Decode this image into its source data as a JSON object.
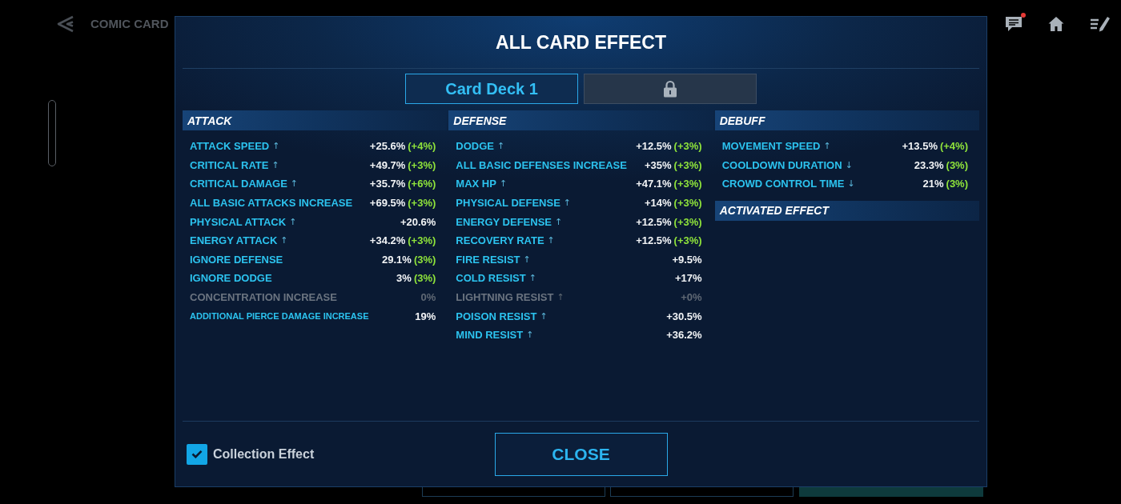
{
  "top_bar": {
    "title": "COMIC CARD",
    "chat_unread": true
  },
  "dialog": {
    "title": "ALL CARD EFFECT",
    "tabs": [
      {
        "label": "Card Deck 1",
        "selected": true,
        "locked": false
      },
      {
        "selected": false,
        "locked": true
      }
    ],
    "columns": [
      {
        "sections": [
          {
            "title": "ATTACK",
            "rows": [
              {
                "label": "ATTACK SPEED",
                "arrow": "↑",
                "value": "+25.6%",
                "bonus": "(+4%)",
                "disabled": false,
                "kind": "normal"
              },
              {
                "label": "CRITICAL RATE",
                "arrow": "↑",
                "value": "+49.7%",
                "bonus": "(+3%)",
                "disabled": false,
                "kind": "normal"
              },
              {
                "label": "CRITICAL DAMAGE",
                "arrow": "↑",
                "value": "+35.7%",
                "bonus": "(+6%)",
                "disabled": false,
                "kind": "normal"
              },
              {
                "label": "ALL BASIC ATTACKS INCREASE",
                "value": "+69.5%",
                "bonus": "(+3%)",
                "disabled": false,
                "kind": "normal"
              },
              {
                "label": "PHYSICAL ATTACK",
                "arrow": "↑",
                "value": "+20.6%",
                "disabled": false,
                "kind": "normal"
              },
              {
                "label": "ENERGY ATTACK",
                "arrow": "↑",
                "value": "+34.2%",
                "bonus": "(+3%)",
                "disabled": false,
                "kind": "normal"
              },
              {
                "label": "IGNORE DEFENSE",
                "value": "29.1%",
                "bonus": "(3%)",
                "disabled": false,
                "kind": "normal"
              },
              {
                "label": "IGNORE DODGE",
                "value": "3%",
                "bonus": "(3%)",
                "disabled": false,
                "kind": "normal"
              },
              {
                "label": "CONCENTRATION INCREASE",
                "value": "0%",
                "disabled": true,
                "kind": "normal"
              },
              {
                "label": "ADDITIONAL PIERCE DAMAGE INCREASE",
                "value": "19%",
                "disabled": false,
                "kind": "small"
              }
            ]
          }
        ]
      },
      {
        "sections": [
          {
            "title": "DEFENSE",
            "rows": [
              {
                "label": "DODGE",
                "arrow": "↑",
                "value": "+12.5%",
                "bonus": "(+3%)",
                "disabled": false,
                "kind": "normal"
              },
              {
                "label": "ALL BASIC DEFENSES INCREASE",
                "value": "+35%",
                "bonus": "(+3%)",
                "disabled": false,
                "kind": "normal"
              },
              {
                "label": "MAX HP",
                "arrow": "↑",
                "value": "+47.1%",
                "bonus": "(+3%)",
                "disabled": false,
                "kind": "normal"
              },
              {
                "label": "PHYSICAL DEFENSE",
                "arrow": "↑",
                "value": "+14%",
                "bonus": "(+3%)",
                "disabled": false,
                "kind": "normal"
              },
              {
                "label": "ENERGY DEFENSE",
                "arrow": "↑",
                "value": "+12.5%",
                "bonus": "(+3%)",
                "disabled": false,
                "kind": "normal"
              },
              {
                "label": "RECOVERY RATE",
                "arrow": "↑",
                "value": "+12.5%",
                "bonus": "(+3%)",
                "disabled": false,
                "kind": "normal"
              },
              {
                "label": "FIRE RESIST",
                "arrow": "↑",
                "value": "+9.5%",
                "disabled": false,
                "kind": "normal"
              },
              {
                "label": "COLD RESIST",
                "arrow": "↑",
                "value": "+17%",
                "disabled": false,
                "kind": "normal"
              },
              {
                "label": "LIGHTNING RESIST",
                "arrow": "↑",
                "value": "+0%",
                "disabled": true,
                "kind": "normal"
              },
              {
                "label": "POISON RESIST",
                "arrow": "↑",
                "value": "+30.5%",
                "disabled": false,
                "kind": "normal"
              },
              {
                "label": "MIND RESIST",
                "arrow": "↑",
                "value": "+36.2%",
                "disabled": false,
                "kind": "normal"
              }
            ]
          }
        ]
      },
      {
        "sections": [
          {
            "title": "DEBUFF",
            "rows": [
              {
                "label": "MOVEMENT SPEED",
                "arrow": "↑",
                "value": "+13.5%",
                "bonus": "(+4%)",
                "disabled": false,
                "kind": "normal"
              },
              {
                "label": "COOLDOWN DURATION",
                "arrow": "↓",
                "value": "23.3%",
                "bonus": "(3%)",
                "disabled": false,
                "kind": "normal"
              },
              {
                "label": "CROWD CONTROL TIME",
                "arrow": "↓",
                "value": "21%",
                "bonus": "(3%)",
                "disabled": false,
                "kind": "normal"
              }
            ]
          },
          {
            "title": "ACTIVATED EFFECT"
          }
        ]
      }
    ],
    "collection_effect": {
      "label": "Collection Effect",
      "checked": true
    },
    "close_button": "CLOSE"
  }
}
